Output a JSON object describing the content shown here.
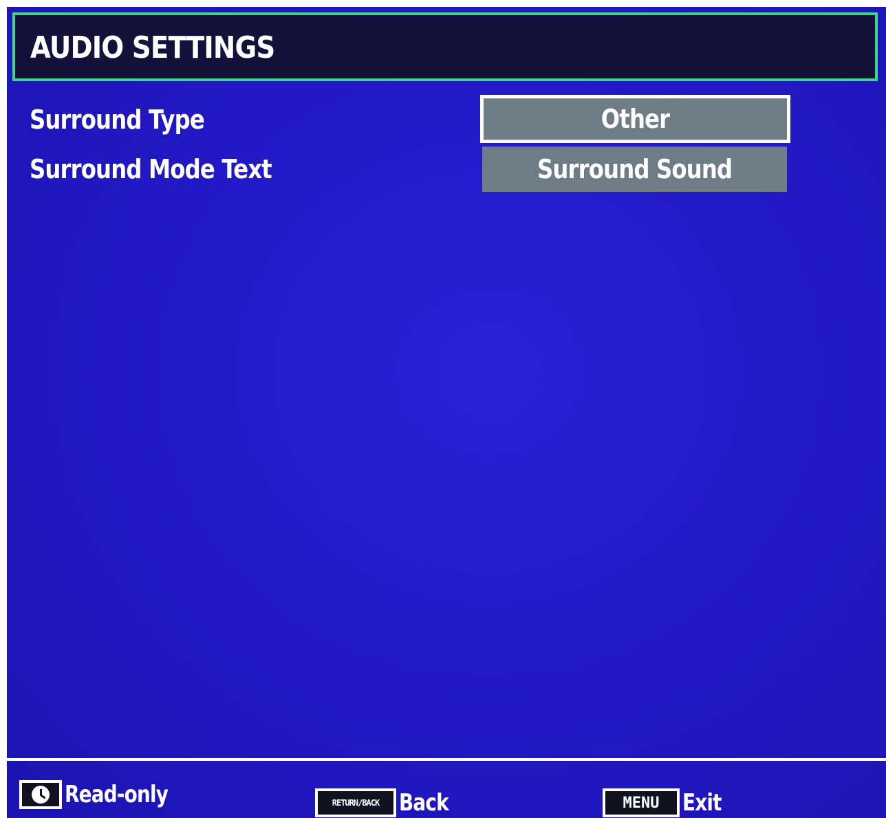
{
  "header": {
    "title": "AUDIO SETTINGS"
  },
  "settings": [
    {
      "label": "Surround Type",
      "value": "Other",
      "selected": true
    },
    {
      "label": "Surround Mode Text",
      "value": "Surround Sound",
      "selected": false
    }
  ],
  "footer": {
    "read_only": {
      "icon": "clock-icon",
      "label": "Read-only"
    },
    "back": {
      "key": "RETURN/BACK",
      "key_label": "RETURN/BACK",
      "label": "Back"
    },
    "exit": {
      "key": "MENU",
      "key_label": "MENU",
      "label": "Exit"
    }
  },
  "colors": {
    "background": "#2219c8",
    "title_bar": "#14123a",
    "title_border": "#3fd68c",
    "value_box": "#6e7c86",
    "text": "#ffffff"
  }
}
